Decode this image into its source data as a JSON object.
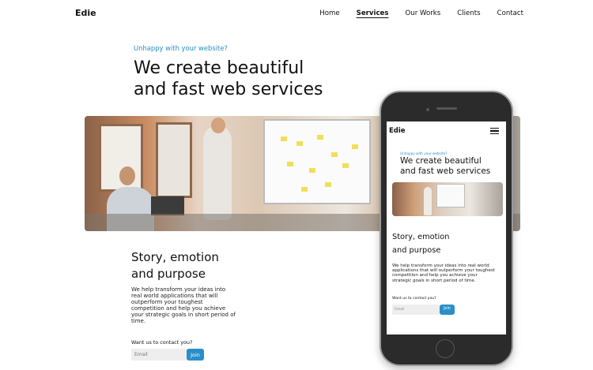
{
  "brand": {
    "name": "Edie"
  },
  "nav": {
    "items": [
      "Home",
      "Services",
      "Our Works",
      "Clients",
      "Contact"
    ],
    "active": "Services"
  },
  "hero": {
    "eyebrow": "Unhappy with your website?",
    "headline_line1": "We create beautiful",
    "headline_line2": "and fast web services",
    "image": "team-meeting-whiteboard"
  },
  "story": {
    "title_line1": "Story, emotion",
    "title_line2": "and purpose",
    "body": "We help transform your ideas into real world applications that will outperform your toughest competition and help you achieve your strategic goals in short period of time."
  },
  "contact": {
    "question": "Want us to contact you?",
    "email_placeholder": "Email",
    "join_label": "Join"
  },
  "colors": {
    "accent": "#2a8fc8",
    "text": "#111111",
    "input_bg": "#eeeeee"
  },
  "icons": {
    "menu": "hamburger-menu-icon"
  }
}
